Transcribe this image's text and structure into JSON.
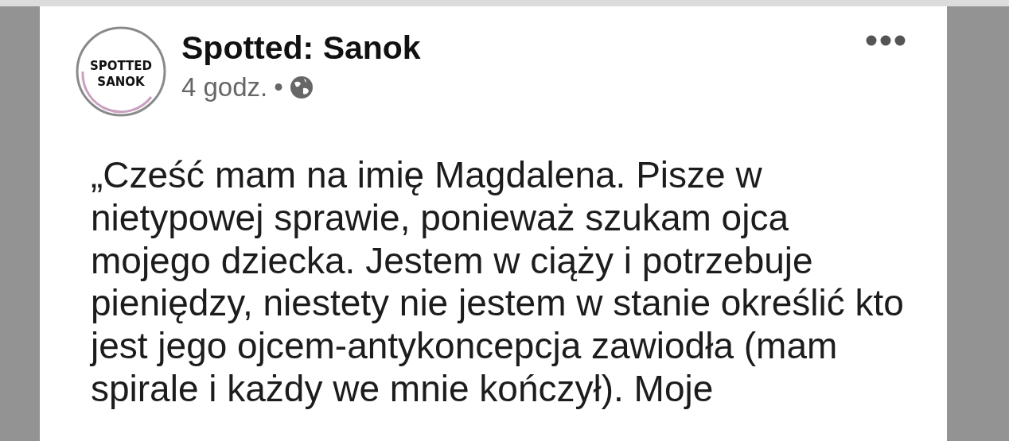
{
  "post": {
    "page_name": "Spotted: Sanok",
    "avatar_text": [
      "SPOTTED",
      "SANOK"
    ],
    "time": "4 godz.",
    "separator": "•",
    "body": "„Cześć mam na imię Magdalena. Pisze w nietypowej sprawie, ponieważ szukam ojca mojego dziecka. Jestem w ciąży i potrzebuje pieniędzy, niestety nie jestem w stanie określić kto jest jego ojcem-antykoncepcja zawiodła (mam spirale i każdy we mnie kończył). Moje"
  }
}
